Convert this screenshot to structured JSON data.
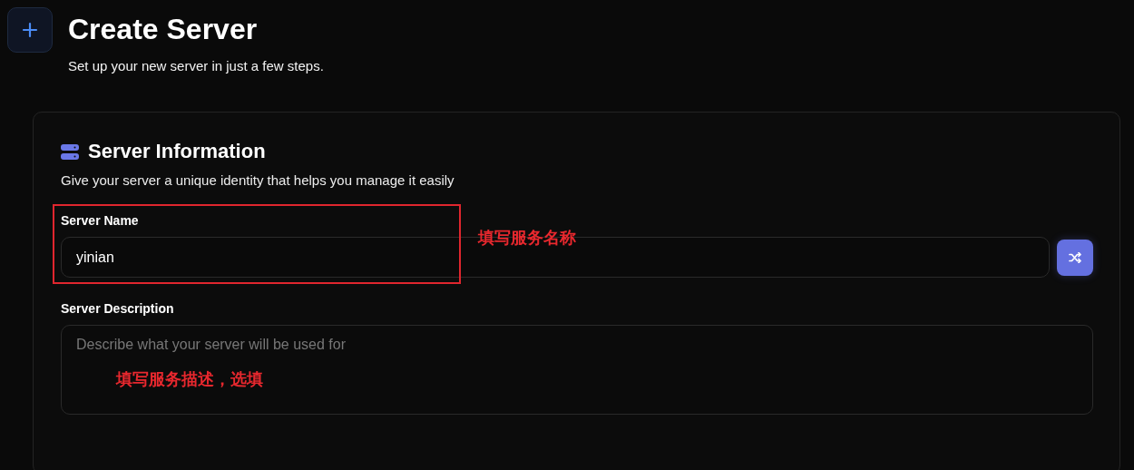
{
  "header": {
    "title": "Create Server",
    "subtitle": "Set up your new server in just a few steps."
  },
  "section": {
    "title": "Server Information",
    "subtitle": "Give your server a unique identity that helps you manage it easily",
    "name_field": {
      "label": "Server Name",
      "value": "yinian"
    },
    "description_field": {
      "label": "Server Description",
      "placeholder": "Describe what your server will be used for"
    }
  },
  "annotations": [
    {
      "kind": "boxed",
      "text": "填写服务名称"
    },
    {
      "kind": "inline",
      "text": "填写服务描述，选填"
    }
  ]
}
